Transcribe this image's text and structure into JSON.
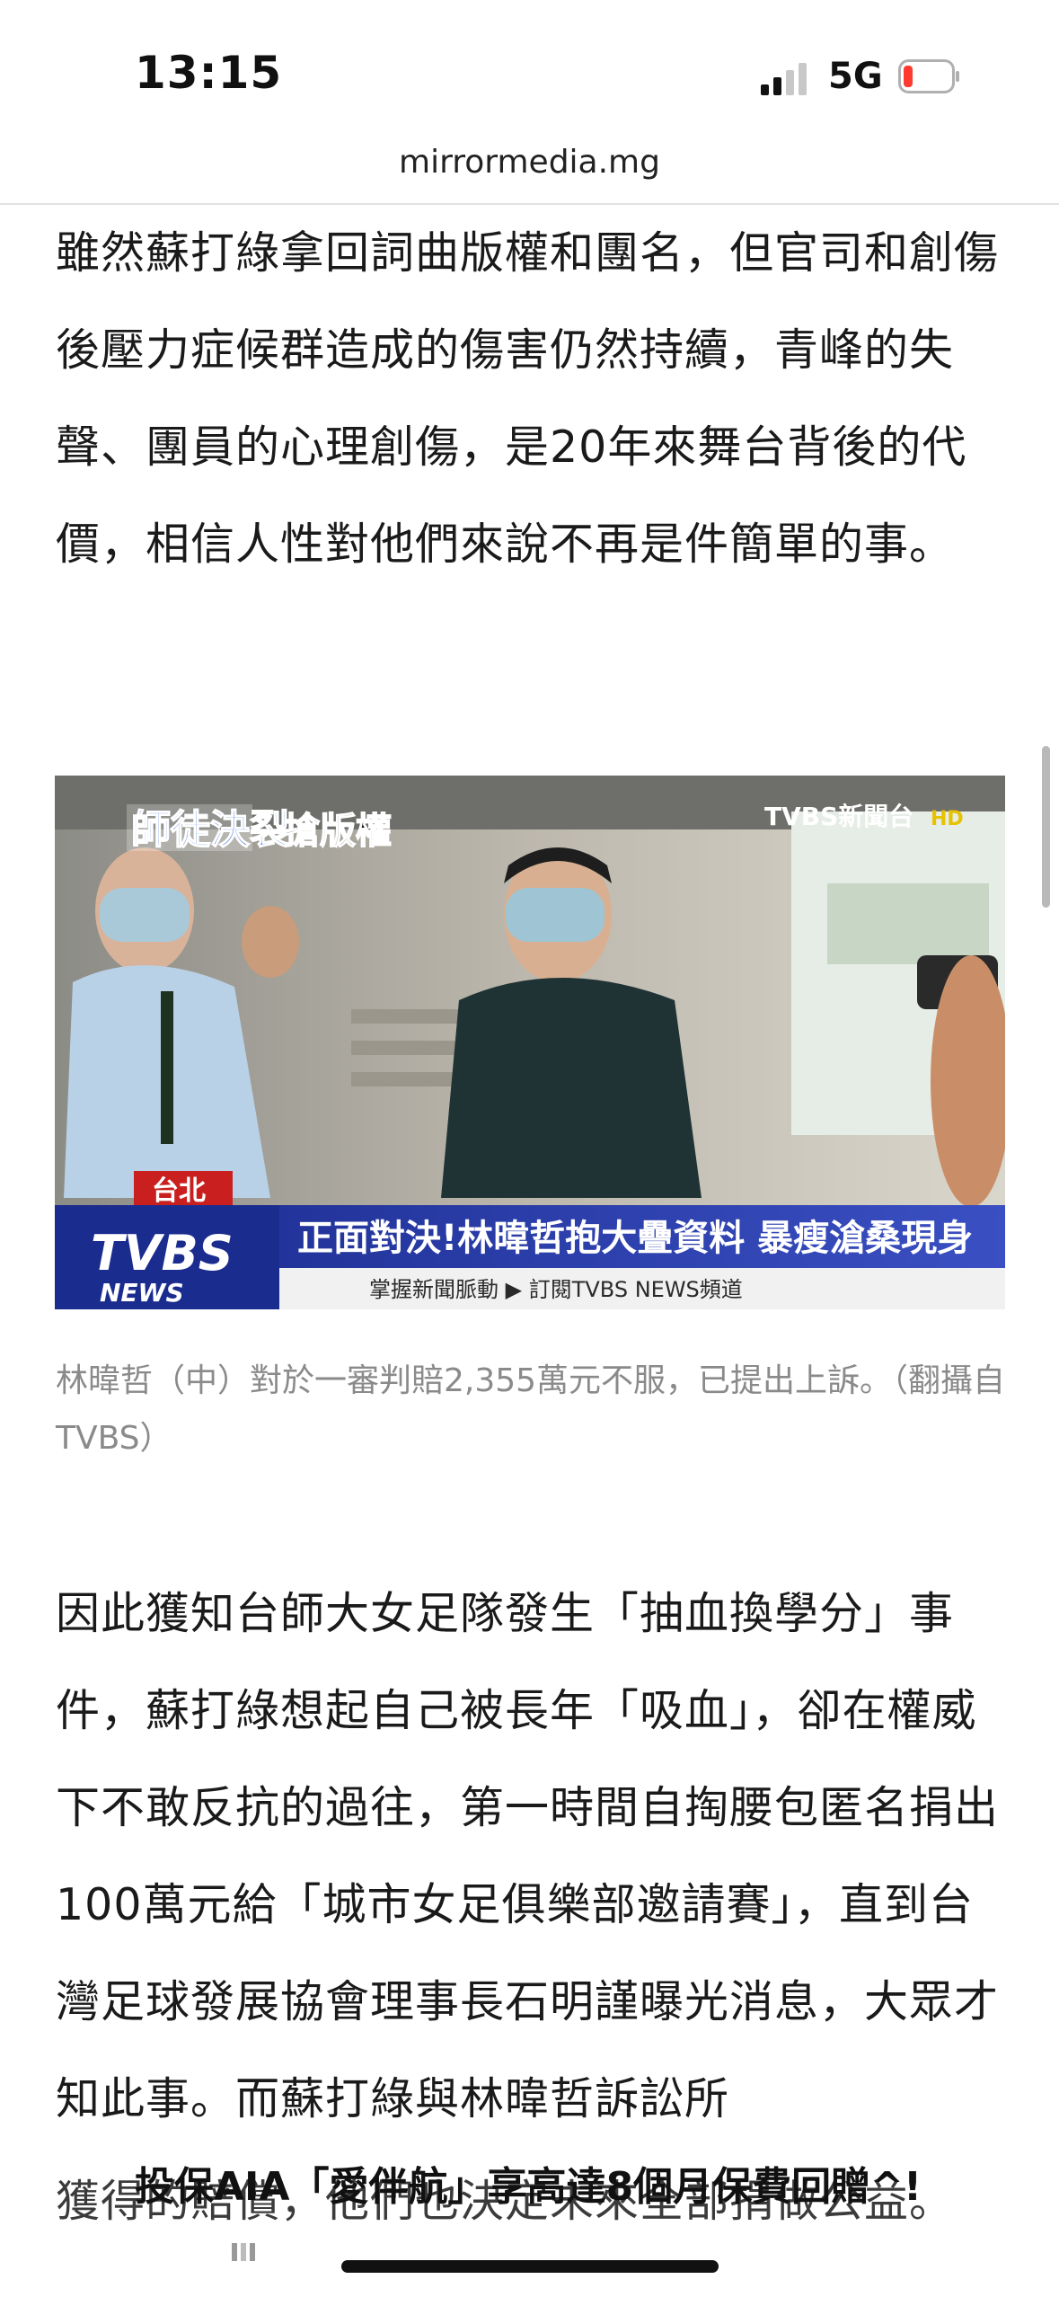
{
  "status": {
    "time": "13:15",
    "network": "5G"
  },
  "browser": {
    "url": "mirrormedia.mg"
  },
  "article": {
    "para1": "雖然蘇打綠拿回詞曲版權和團名，但官司和創傷後壓力症候群造成的傷害仍然持續，青峰的失聲、團員的心理創傷，是20年來舞台背後的代價，相信人性對他們來說不再是件簡單的事。",
    "photo": {
      "banner_left_a": "師徒決裂",
      "banner_left_b": "搶版權",
      "channel_logo": "TVBS新聞台",
      "hd": "HD",
      "location": "台北",
      "headline": "正面對決!林暐哲抱大疊資料 暴瘦滄桑現身",
      "ticker": "掌握新聞脈動 ▶ 訂閱TVBS NEWS頻道",
      "news_logo": "TVBS",
      "news_sub": "NEWS"
    },
    "caption": "林暐哲（中）對於一審判賠2,355萬元不服，已提出上訴。（翻攝自TVBS）",
    "para2": "因此獲知台師大女足隊發生「抽血換學分」事件，蘇打綠想起自己被長年「吸血」，卻在權威下不敢反抗的過往，第一時間自掏腰包匿名捐出100萬元給「城市女足俱樂部邀請賽」，直到台灣足球發展協會理事長石明謹曝光消息，大眾才知此事。而蘇打綠與林暐哲訴訟所",
    "para2_tail": "獲得的賠償，他們也決定未來全部捐做公益。"
  },
  "ad": {
    "text": "投保AIA「愛伴航」享高達8個月保費回贈^!"
  }
}
